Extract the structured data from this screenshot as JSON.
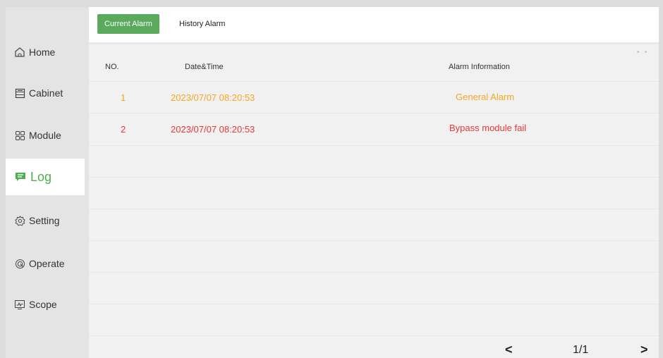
{
  "sidebar": {
    "items": [
      {
        "label": "Home",
        "icon": "home-icon"
      },
      {
        "label": "Cabinet",
        "icon": "cabinet-icon"
      },
      {
        "label": "Module",
        "icon": "module-icon"
      },
      {
        "label": "Log",
        "icon": "log-icon",
        "active": true
      },
      {
        "label": "Setting",
        "icon": "gear-icon"
      },
      {
        "label": "Operate",
        "icon": "operate-icon"
      },
      {
        "label": "Scope",
        "icon": "scope-icon"
      }
    ]
  },
  "tabs": {
    "current": "Current Alarm",
    "history": "History Alarm"
  },
  "table": {
    "headers": {
      "no": "NO.",
      "datetime": "Date&Time",
      "info": "Alarm Information"
    },
    "rows": [
      {
        "no": "1",
        "datetime": "2023/07/07 08:20:53",
        "info": "General Alarm",
        "color": "#f5a623"
      },
      {
        "no": "2",
        "datetime": "2023/07/07 08:20:53",
        "info": "Bypass module fail",
        "color": "#e53935"
      }
    ]
  },
  "pager": {
    "page": "1/1",
    "prev": "<",
    "next": ">"
  },
  "colors": {
    "accent": "#5aa95c",
    "active_nav_text": "#4caf50",
    "general_alarm": "#f5a623",
    "fail_alarm": "#e53935"
  }
}
